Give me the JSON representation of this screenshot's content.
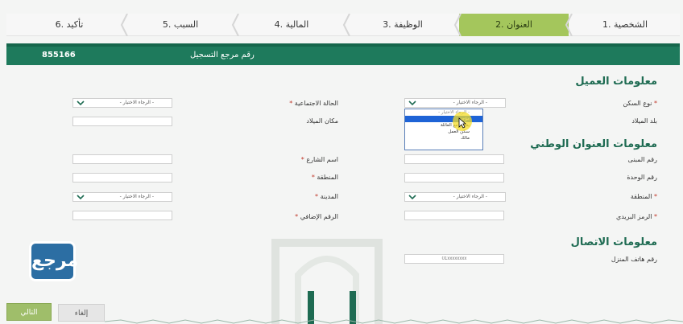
{
  "stepper": {
    "steps": [
      "1. الشخصية",
      "2. العنوان",
      "3. الوظيفة",
      "4. المالية",
      "5. السبب",
      "6. تأكيد"
    ],
    "active_index": 1
  },
  "reference": {
    "label": "رقم مرجع التسجيل",
    "value": "855166"
  },
  "client_info": {
    "title": "معلومات العميل",
    "housing_type_label": "نوع السكن",
    "housing_type_value": "- الرجاء الاختيار -",
    "marital_status_label": "الحالة الاجتماعية",
    "marital_status_value": "- الرجاء الاختيار -",
    "birth_country_label": "بلد الميلاد",
    "birth_place_label": "مكان الميلاد"
  },
  "housing_dropdown": {
    "options": [
      "- الرجاء الاختيار -",
      "مؤجر",
      "يعيش مع العائلة",
      "سكن العمل",
      "مالك"
    ],
    "highlighted_index": 1
  },
  "national_address": {
    "title": "معلومات العنوان الوطني",
    "building_no_label": "رقم المبنى",
    "street_name_label": "اسم الشارع",
    "unit_no_label": "رقم الوحدة",
    "district_label": "المنطقة",
    "region_label": "المنطقة",
    "region_value": "- الرجاء الاختيار -",
    "city_label": "المدينة",
    "city_value": "- الرجاء الاختيار -",
    "postal_code_label": "الرمز البريدي",
    "additional_no_label": "الرقم الإضافي"
  },
  "contact": {
    "title": "معلومات الاتصال",
    "home_phone_label": "رقم هاتف المنزل",
    "home_phone_placeholder": "01xxxxxxxx"
  },
  "buttons": {
    "next": "التالي",
    "cancel": "إلغاء"
  },
  "logo_text": "مرجع",
  "colors": {
    "primary_green": "#1e7a5c",
    "active_step": "#a4c65c",
    "section_title": "#1e6b52",
    "required": "#c0392b",
    "dropdown_highlight": "#1e63d6"
  }
}
